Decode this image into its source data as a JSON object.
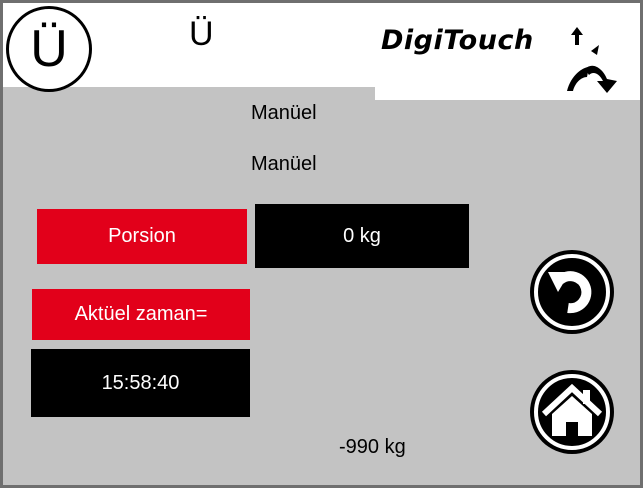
{
  "header": {
    "badge_char": "Ü",
    "title_char": "Ü",
    "logo_text": "DigiTouch"
  },
  "mode": {
    "line1": "Manüel",
    "line2": "Manüel"
  },
  "portion": {
    "label": "Porsion",
    "value": "0 kg"
  },
  "time": {
    "label": "Aktüel zaman=",
    "value": "15:58:40"
  },
  "weight": {
    "value": "-990 kg"
  },
  "buttons": {
    "back_icon": "back-arrow-icon",
    "home_icon": "home-icon"
  },
  "colors": {
    "background": "#c3c3c3",
    "red": "#e2001a",
    "black": "#000000"
  }
}
